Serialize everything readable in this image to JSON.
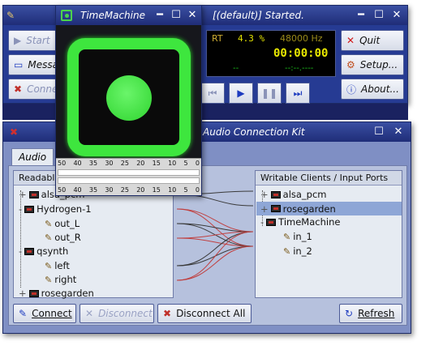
{
  "daemon": {
    "title": "[(default)] Started.",
    "lcd": {
      "rt_label": "RT",
      "cpu_load": "4.3 %",
      "sample_rate": "48000 Hz",
      "time_main": "00:00:00",
      "time_sub_left": "--",
      "time_sub_right": "--:--.----"
    },
    "left_buttons": [
      {
        "label": "Start",
        "icon": "play-icon"
      },
      {
        "label": "Messages",
        "icon": "messages-icon"
      },
      {
        "label": "Connect",
        "icon": "connect-icon"
      }
    ],
    "right_buttons": [
      {
        "label": "Quit",
        "icon": "quit-icon"
      },
      {
        "label": "Setup...",
        "icon": "setup-icon"
      },
      {
        "label": "About...",
        "icon": "info-icon"
      }
    ]
  },
  "kit": {
    "title": "Audio Connection Kit",
    "tabs": [
      "Audio"
    ],
    "readable_header": "Readable Clients / Output Ports",
    "writable_header": "Writable Clients / Input Ports",
    "readable_clients": [
      {
        "name": "alsa_pcm",
        "ports": []
      },
      {
        "name": "Hydrogen-1",
        "ports": [
          "out_L",
          "out_R"
        ]
      },
      {
        "name": "qsynth",
        "ports": [
          "left",
          "right"
        ]
      },
      {
        "name": "rosegarden",
        "ports": []
      }
    ],
    "writable_clients": [
      {
        "name": "alsa_pcm",
        "ports": []
      },
      {
        "name": "rosegarden",
        "ports": []
      },
      {
        "name": "TimeMachine",
        "ports": [
          "in_1",
          "in_2"
        ]
      }
    ],
    "buttons": {
      "connect": "Connect",
      "disconnect": "Disconnect",
      "disconnect_all": "Disconnect All",
      "refresh": "Refresh"
    }
  },
  "timemachine": {
    "title": "TimeMachine",
    "meter_scale": [
      "50",
      "40",
      "35",
      "30",
      "25",
      "20",
      "15",
      "10",
      "5",
      "0"
    ]
  }
}
